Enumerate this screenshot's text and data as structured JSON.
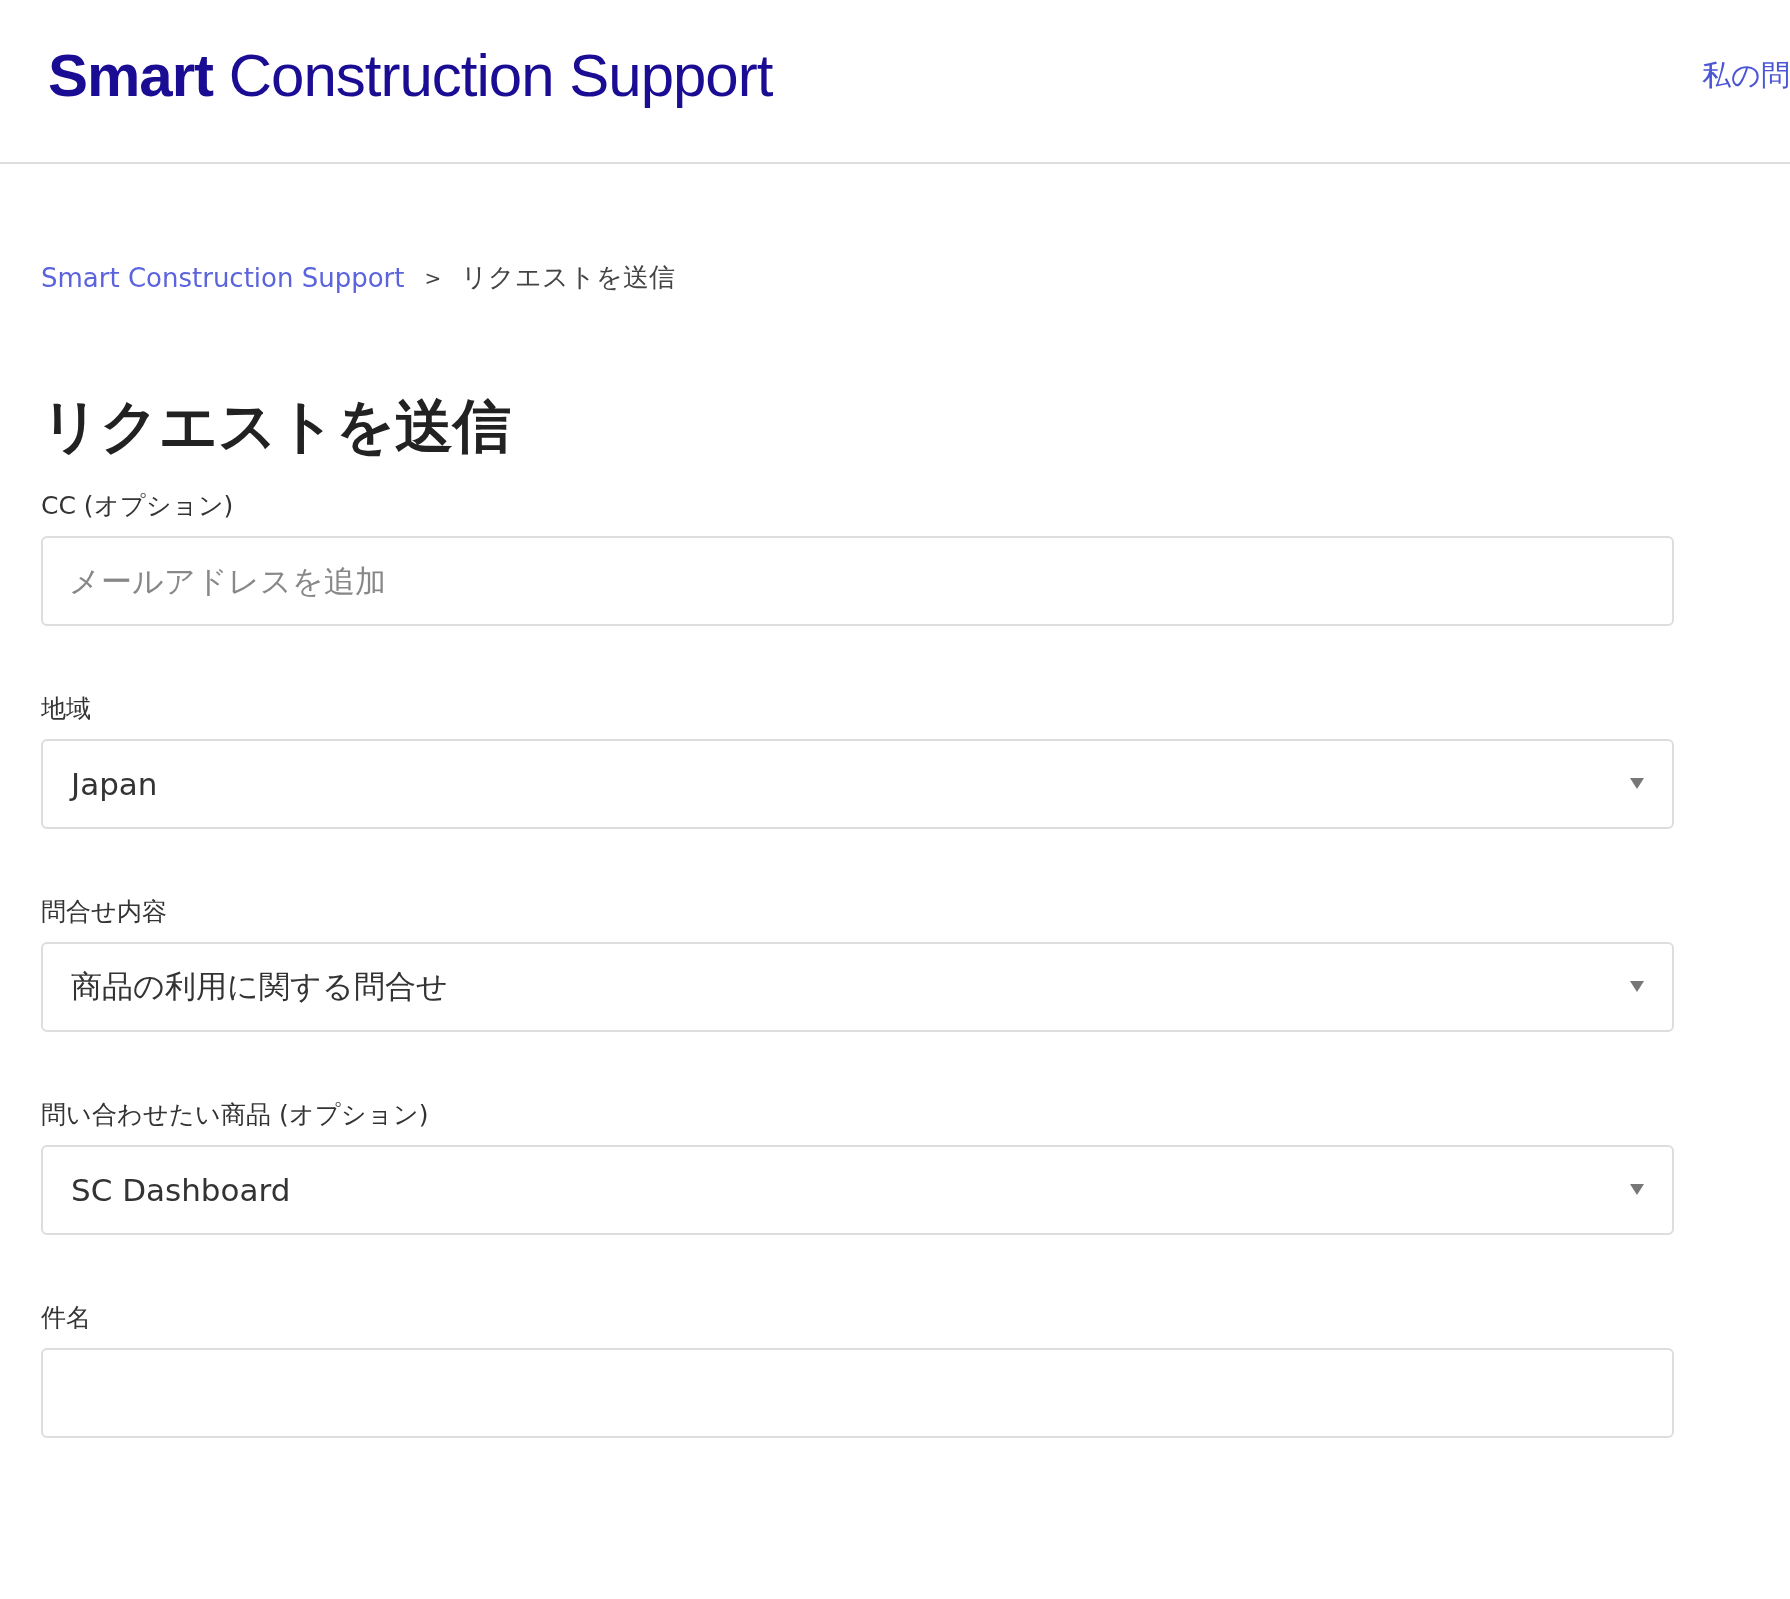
{
  "header": {
    "logo": "**Smart** Construction Support",
    "nav_link": "私の問"
  },
  "breadcrumb": {
    "items": [
      {
        "label": "Smart Construction Support",
        "kind": "link"
      },
      {
        "label": "リクエストを送信",
        "kind": "current"
      }
    ],
    "separator": ">"
  },
  "title": "リクエストを送信",
  "fields": [
    {
      "label": "CC (オプション)",
      "kind": "text",
      "placeholder": "メールアドレスを追加"
    },
    {
      "label": "地域",
      "kind": "select",
      "value": "Japan"
    },
    {
      "label": "問合せ内容",
      "kind": "select",
      "value": "商品の利用に関する問合せ"
    },
    {
      "label": "問い合わせたい商品 (オプション)",
      "kind": "select",
      "value": "SC Dashboard"
    },
    {
      "label": "件名",
      "kind": "text"
    }
  ]
}
